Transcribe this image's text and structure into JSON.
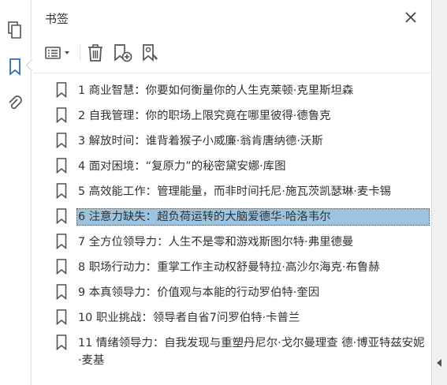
{
  "panel": {
    "title": "书签"
  },
  "left_rail": {
    "icons": [
      "pages-icon",
      "bookmark-icon",
      "attachment-icon"
    ]
  },
  "colors": {
    "selection": "#9cc3df",
    "accent_blue": "#2f6fb5",
    "icon_gray": "#555555"
  },
  "bookmarks": [
    {
      "label": "1 商业智慧：你要如何衡量你的人生克莱顿·克里斯坦森"
    },
    {
      "label": "2 自我管理：你的职场上限究竟在哪里彼得·德鲁克"
    },
    {
      "label": "3 解放时间：谁背着猴子小威廉·翁肯唐纳德·沃斯"
    },
    {
      "label": "4 面对困境：“复原力”的秘密黛安娜·库图"
    },
    {
      "label": "5 高效能工作：管理能量，而非时间托尼·施瓦茨凯瑟琳·麦卡锡"
    },
    {
      "label": "6 注意力缺失：超负荷运转的大脑爱德华·哈洛韦尔",
      "selected": true
    },
    {
      "label": "7 全方位领导力：人生不是零和游戏斯图尔特·弗里德曼"
    },
    {
      "label": "8 职场行动力：重掌工作主动权舒曼特拉·高沙尔海克·布鲁赫"
    },
    {
      "label": "9 本真领导力：价值观与本能的行动罗伯特·奎因"
    },
    {
      "label": "10 职业挑战：领导者自省7问罗伯特·卡普兰"
    },
    {
      "label": "11 情绪领导力：自我发现与重塑丹尼尔·戈尔曼理查 德·博亚特兹安妮·麦基"
    }
  ]
}
